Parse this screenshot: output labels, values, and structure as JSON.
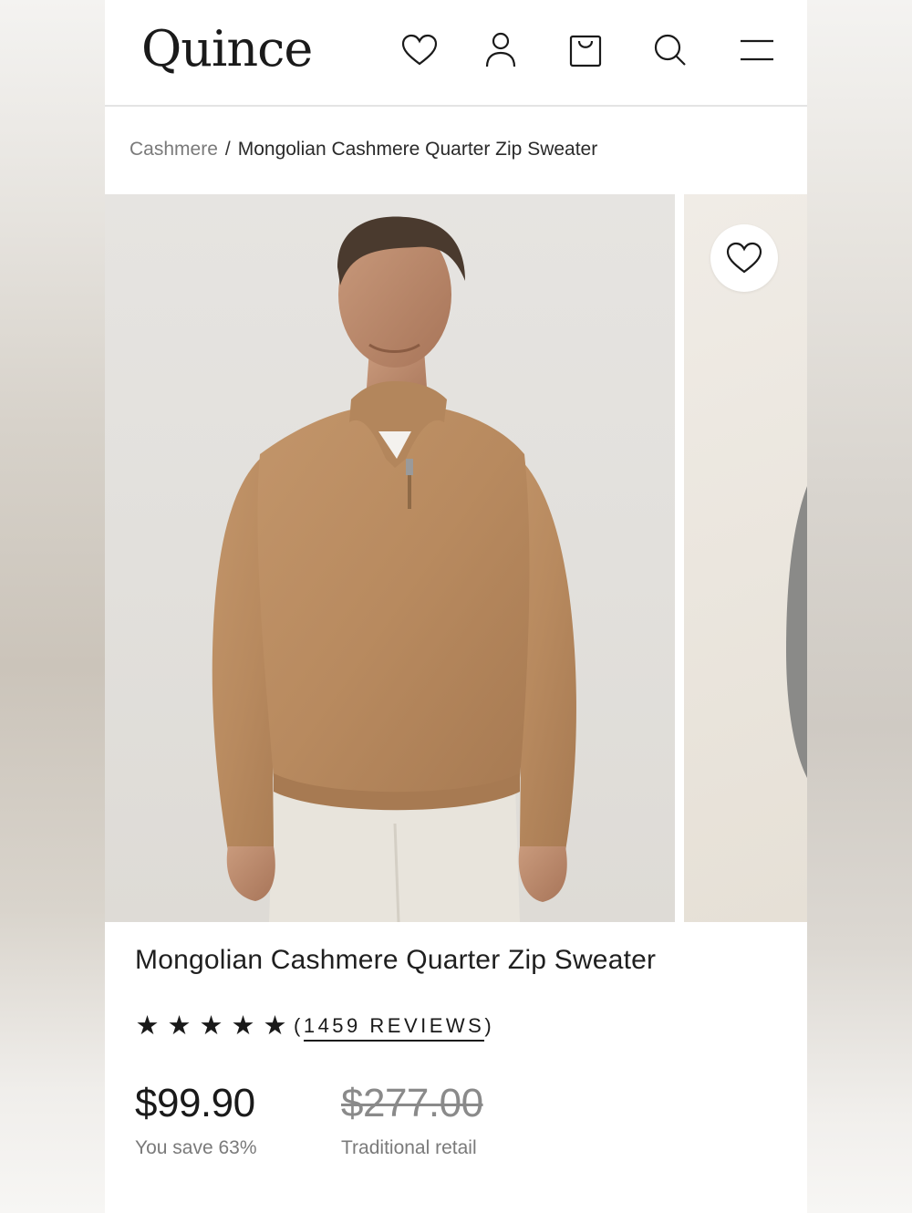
{
  "header": {
    "logo": "Quince",
    "icons": [
      "heart-icon",
      "account-icon",
      "bag-icon",
      "search-icon",
      "menu-icon"
    ]
  },
  "breadcrumb": {
    "parent": "Cashmere",
    "separator": "/",
    "current": "Mongolian Cashmere Quarter Zip Sweater"
  },
  "gallery": {
    "images": [
      {
        "alt": "Man wearing camel cashmere quarter zip sweater",
        "color": "#b98b61"
      },
      {
        "alt": "Grey sweater",
        "color": "#8a8a88"
      }
    ]
  },
  "product": {
    "title": "Mongolian Cashmere Quarter Zip Sweater",
    "rating": {
      "stars": 5,
      "open_paren": "(",
      "reviews_text": "1459 REVIEWS",
      "close_paren": ")"
    },
    "price": "$99.90",
    "savings": "You save 63%",
    "retail_price": "$277.00",
    "retail_label": "Traditional retail"
  },
  "colors": {
    "text": "#1a1a1a",
    "muted": "#7a7a7a",
    "sweater": "#b98b61"
  }
}
